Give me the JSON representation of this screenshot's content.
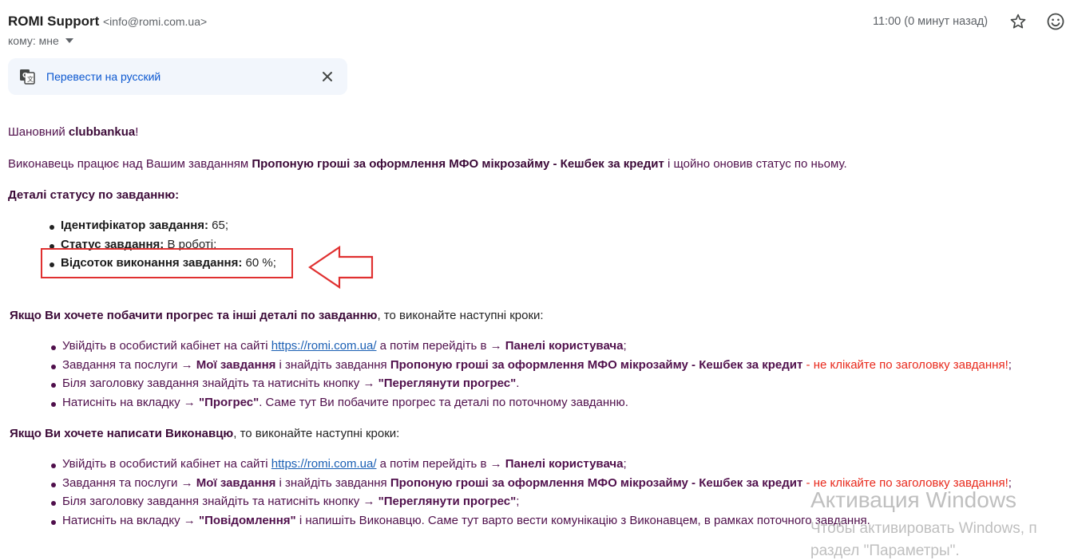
{
  "header": {
    "sender_name": "ROMI Support",
    "sender_email": "<info@romi.com.ua>",
    "recipient": "кому: мне",
    "time": "11:00 (0 минут назад)"
  },
  "translate": {
    "label": "Перевести на русский"
  },
  "body": {
    "greeting_prefix": "Шановний ",
    "greeting_name": "clubbankua",
    "greeting_suffix": "!",
    "intro_prefix": "Виконавець працює над Вашим завданням ",
    "task_name": "Пропоную гроші за оформлення МФО мікрозайму - Кешбек за кредит",
    "intro_suffix": " і щойно оновив статус по ньому.",
    "details_heading": "Деталі статусу по завданню:",
    "status_items": [
      {
        "label": "Ідентифікатор завдання:",
        "value": " 65;"
      },
      {
        "label": "Статус завдання:",
        "value": " В роботі;"
      },
      {
        "label": "Відсоток виконання завдання:",
        "value": " 60 %;"
      }
    ],
    "progress_heading": {
      "bold": "Якщо Ви хочете побачити прогрес та інші деталі по завданню",
      "rest": ", то виконайте наступні кроки:"
    },
    "message_heading": {
      "bold": "Якщо Ви хочете написати Виконавцю",
      "rest": ", то виконайте наступні кроки:"
    },
    "step_login": {
      "prefix": "Увійдіть в особистий кабінет на сайті ",
      "link": "https://romi.com.ua/",
      "middle": " а потім перейдіть в → ",
      "bold": "Панелі користувача",
      "suffix": ";"
    },
    "step_tasks": {
      "prefix": "Завдання та послуги → ",
      "bold1": "Мої завдання",
      "middle": " і знайдіть завдання ",
      "bold2": "Пропоную гроші за оформлення МФО мікрозайму - Кешбек за кредит",
      "dash": " - ",
      "warning": "не клікайте по заголовку завдання!",
      "suffix": ";"
    },
    "step_button": {
      "prefix": "Біля заголовку завдання знайдіть та натисніть кнопку → ",
      "bold": "\"Переглянути прогрес\"",
      "suffix_1": ".",
      "suffix_2": ";"
    },
    "step_tab_progress": {
      "prefix": "Натисніть на вкладку → ",
      "bold": "\"Прогрес\"",
      "suffix": ". Саме тут Ви побачите прогрес та деталі по поточному завданню."
    },
    "step_tab_messages": {
      "prefix": "Натисніть на вкладку → ",
      "bold": "\"Повідомлення\"",
      "suffix": " і напишіть Виконавцю. Саме тут варто вести комунікацію з Виконавцем, в рамках поточного завдання."
    }
  },
  "watermark": {
    "title": "Активация Windows",
    "subtitle": "Чтобы активировать Windows, п",
    "subtitle2": "раздел \"Параметры\"."
  },
  "colors": {
    "text_purple": "#50104c",
    "warning_red": "#e8281b",
    "link_blue": "#1a5fb4",
    "annotation_red": "#e03030"
  },
  "icons": [
    "star-icon",
    "emoji-icon",
    "translate-icon",
    "close-icon",
    "arrow-annotation-icon"
  ]
}
